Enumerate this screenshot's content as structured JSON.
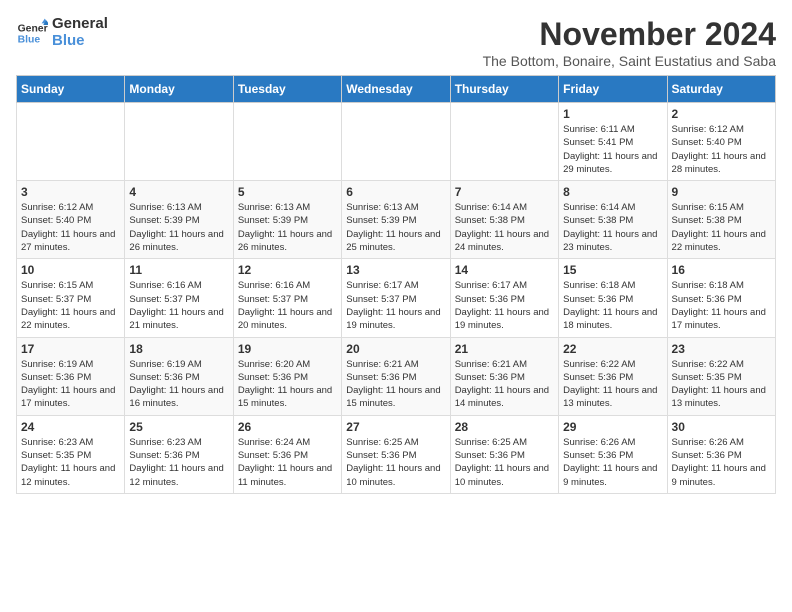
{
  "logo": {
    "line1": "General",
    "line2": "Blue"
  },
  "title": "November 2024",
  "subtitle": "The Bottom, Bonaire, Saint Eustatius and Saba",
  "weekdays": [
    "Sunday",
    "Monday",
    "Tuesday",
    "Wednesday",
    "Thursday",
    "Friday",
    "Saturday"
  ],
  "weeks": [
    [
      {
        "day": "",
        "info": ""
      },
      {
        "day": "",
        "info": ""
      },
      {
        "day": "",
        "info": ""
      },
      {
        "day": "",
        "info": ""
      },
      {
        "day": "",
        "info": ""
      },
      {
        "day": "1",
        "info": "Sunrise: 6:11 AM\nSunset: 5:41 PM\nDaylight: 11 hours and 29 minutes."
      },
      {
        "day": "2",
        "info": "Sunrise: 6:12 AM\nSunset: 5:40 PM\nDaylight: 11 hours and 28 minutes."
      }
    ],
    [
      {
        "day": "3",
        "info": "Sunrise: 6:12 AM\nSunset: 5:40 PM\nDaylight: 11 hours and 27 minutes."
      },
      {
        "day": "4",
        "info": "Sunrise: 6:13 AM\nSunset: 5:39 PM\nDaylight: 11 hours and 26 minutes."
      },
      {
        "day": "5",
        "info": "Sunrise: 6:13 AM\nSunset: 5:39 PM\nDaylight: 11 hours and 26 minutes."
      },
      {
        "day": "6",
        "info": "Sunrise: 6:13 AM\nSunset: 5:39 PM\nDaylight: 11 hours and 25 minutes."
      },
      {
        "day": "7",
        "info": "Sunrise: 6:14 AM\nSunset: 5:38 PM\nDaylight: 11 hours and 24 minutes."
      },
      {
        "day": "8",
        "info": "Sunrise: 6:14 AM\nSunset: 5:38 PM\nDaylight: 11 hours and 23 minutes."
      },
      {
        "day": "9",
        "info": "Sunrise: 6:15 AM\nSunset: 5:38 PM\nDaylight: 11 hours and 22 minutes."
      }
    ],
    [
      {
        "day": "10",
        "info": "Sunrise: 6:15 AM\nSunset: 5:37 PM\nDaylight: 11 hours and 22 minutes."
      },
      {
        "day": "11",
        "info": "Sunrise: 6:16 AM\nSunset: 5:37 PM\nDaylight: 11 hours and 21 minutes."
      },
      {
        "day": "12",
        "info": "Sunrise: 6:16 AM\nSunset: 5:37 PM\nDaylight: 11 hours and 20 minutes."
      },
      {
        "day": "13",
        "info": "Sunrise: 6:17 AM\nSunset: 5:37 PM\nDaylight: 11 hours and 19 minutes."
      },
      {
        "day": "14",
        "info": "Sunrise: 6:17 AM\nSunset: 5:36 PM\nDaylight: 11 hours and 19 minutes."
      },
      {
        "day": "15",
        "info": "Sunrise: 6:18 AM\nSunset: 5:36 PM\nDaylight: 11 hours and 18 minutes."
      },
      {
        "day": "16",
        "info": "Sunrise: 6:18 AM\nSunset: 5:36 PM\nDaylight: 11 hours and 17 minutes."
      }
    ],
    [
      {
        "day": "17",
        "info": "Sunrise: 6:19 AM\nSunset: 5:36 PM\nDaylight: 11 hours and 17 minutes."
      },
      {
        "day": "18",
        "info": "Sunrise: 6:19 AM\nSunset: 5:36 PM\nDaylight: 11 hours and 16 minutes."
      },
      {
        "day": "19",
        "info": "Sunrise: 6:20 AM\nSunset: 5:36 PM\nDaylight: 11 hours and 15 minutes."
      },
      {
        "day": "20",
        "info": "Sunrise: 6:21 AM\nSunset: 5:36 PM\nDaylight: 11 hours and 15 minutes."
      },
      {
        "day": "21",
        "info": "Sunrise: 6:21 AM\nSunset: 5:36 PM\nDaylight: 11 hours and 14 minutes."
      },
      {
        "day": "22",
        "info": "Sunrise: 6:22 AM\nSunset: 5:36 PM\nDaylight: 11 hours and 13 minutes."
      },
      {
        "day": "23",
        "info": "Sunrise: 6:22 AM\nSunset: 5:35 PM\nDaylight: 11 hours and 13 minutes."
      }
    ],
    [
      {
        "day": "24",
        "info": "Sunrise: 6:23 AM\nSunset: 5:35 PM\nDaylight: 11 hours and 12 minutes."
      },
      {
        "day": "25",
        "info": "Sunrise: 6:23 AM\nSunset: 5:36 PM\nDaylight: 11 hours and 12 minutes."
      },
      {
        "day": "26",
        "info": "Sunrise: 6:24 AM\nSunset: 5:36 PM\nDaylight: 11 hours and 11 minutes."
      },
      {
        "day": "27",
        "info": "Sunrise: 6:25 AM\nSunset: 5:36 PM\nDaylight: 11 hours and 10 minutes."
      },
      {
        "day": "28",
        "info": "Sunrise: 6:25 AM\nSunset: 5:36 PM\nDaylight: 11 hours and 10 minutes."
      },
      {
        "day": "29",
        "info": "Sunrise: 6:26 AM\nSunset: 5:36 PM\nDaylight: 11 hours and 9 minutes."
      },
      {
        "day": "30",
        "info": "Sunrise: 6:26 AM\nSunset: 5:36 PM\nDaylight: 11 hours and 9 minutes."
      }
    ]
  ]
}
